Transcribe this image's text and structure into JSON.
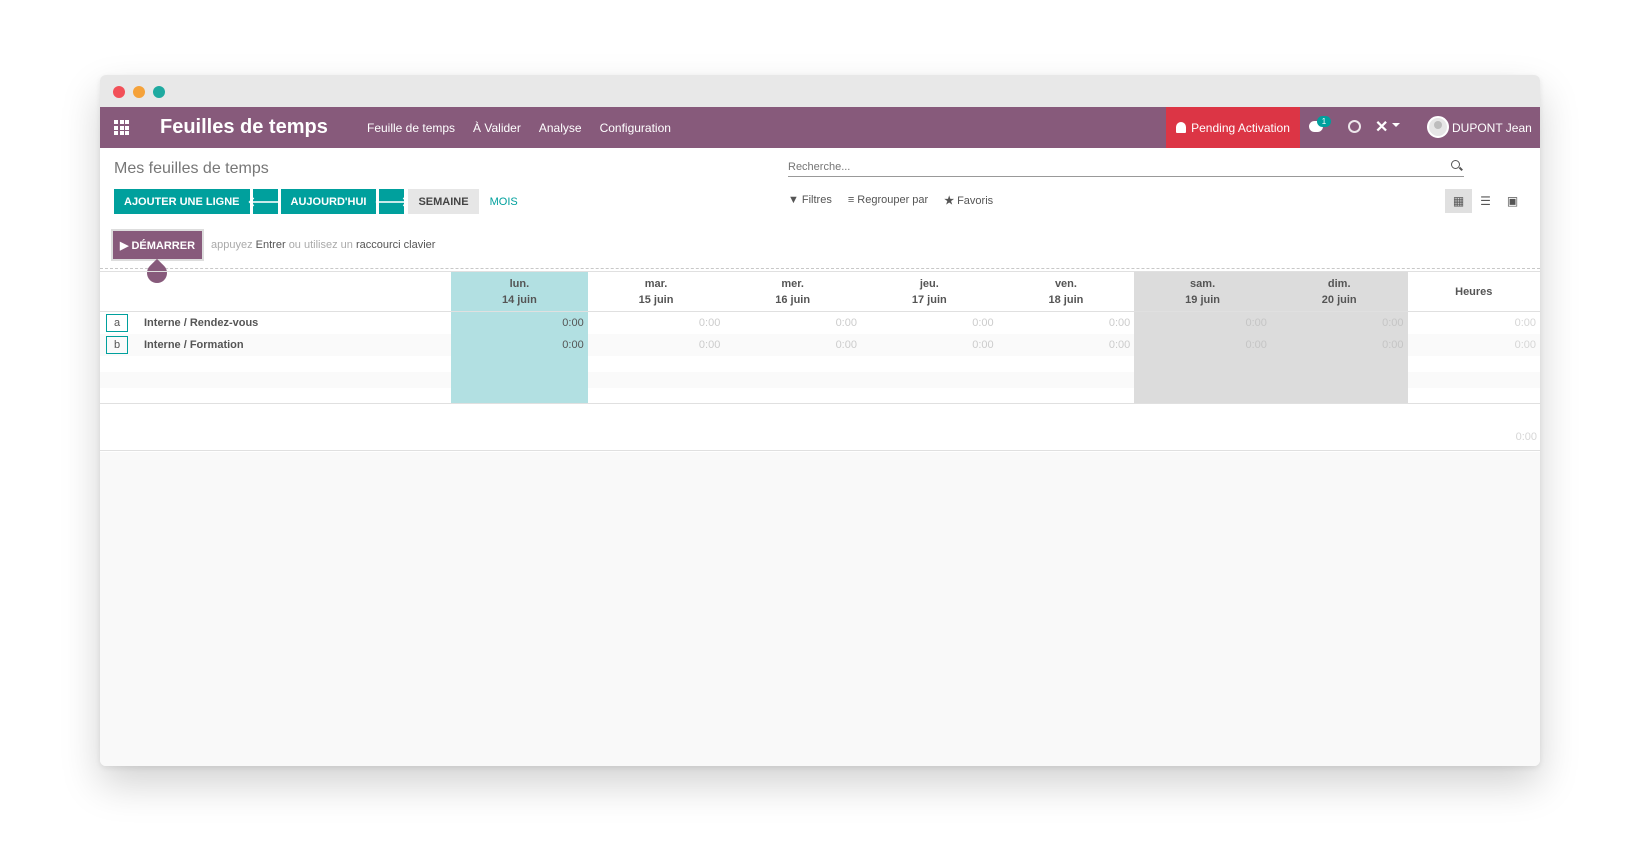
{
  "window": {
    "traffic_lights": [
      "close",
      "minimize",
      "maximize"
    ]
  },
  "navbar": {
    "brand": "Feuilles de temps",
    "menu": [
      "Feuille de temps",
      "À Valider",
      "Analyse",
      "Configuration"
    ],
    "pending_label": "Pending Activation",
    "chat_badge": "1",
    "tools_icon": "✕",
    "user_name": "DUPONT Jean"
  },
  "control": {
    "breadcrumb": "Mes feuilles de temps",
    "search_placeholder": "Recherche...",
    "buttons": {
      "add_line": "AJOUTER UNE LIGNE",
      "prev": "🡐",
      "today": "AUJOURD'HUI",
      "next": "🡒",
      "week": "SEMAINE",
      "month": "MOIS"
    },
    "filters": {
      "filters": "Filtres",
      "group_by": "Regrouper par",
      "favorites": "Favoris"
    },
    "start_button": "▶ DÉMARRER",
    "hint": {
      "p1": "appuyez",
      "k1": "Entrer",
      "p2": "ou utilisez un",
      "k2": "raccourci clavier"
    }
  },
  "grid": {
    "days": [
      {
        "day": "lun.",
        "date": "14 juin"
      },
      {
        "day": "mar.",
        "date": "15 juin"
      },
      {
        "day": "mer.",
        "date": "16 juin"
      },
      {
        "day": "jeu.",
        "date": "17 juin"
      },
      {
        "day": "ven.",
        "date": "18 juin"
      },
      {
        "day": "sam.",
        "date": "19 juin"
      },
      {
        "day": "dim.",
        "date": "20 juin"
      }
    ],
    "total_header": "Heures",
    "rows": [
      {
        "key": "a",
        "label": "Interne / Rendez-vous",
        "values": [
          "0:00",
          "0:00",
          "0:00",
          "0:00",
          "0:00",
          "0:00",
          "0:00"
        ],
        "total": "0:00"
      },
      {
        "key": "b",
        "label": "Interne / Formation",
        "values": [
          "0:00",
          "0:00",
          "0:00",
          "0:00",
          "0:00",
          "0:00",
          "0:00"
        ],
        "total": "0:00"
      }
    ],
    "grand_total": "0:00"
  },
  "colors": {
    "primary": "#875a7b",
    "accent": "#00a09d",
    "danger": "#dc3545",
    "today_col": "#b2e0e2",
    "weekend_col": "#dcdcdc"
  }
}
